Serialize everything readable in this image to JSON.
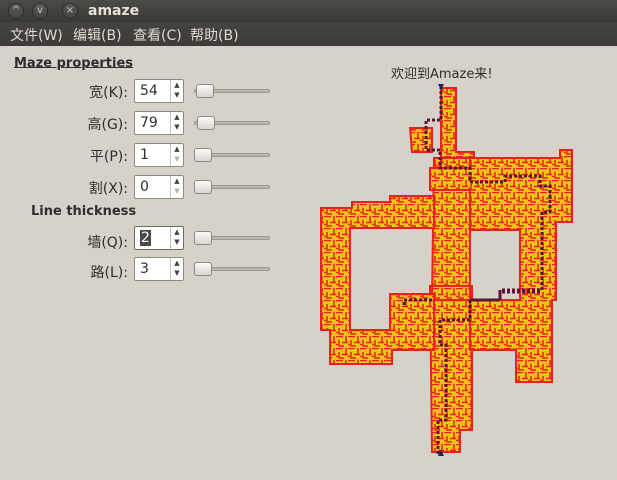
{
  "window": {
    "title": "amaze",
    "minimize_glyph": "^",
    "restore_glyph": "v",
    "close_glyph": "×"
  },
  "menu": [
    "文件(W)",
    "编辑(B)",
    "查看(C)",
    "帮助(B)"
  ],
  "maze_properties": {
    "title": "Maze properties",
    "rows": [
      {
        "label": "宽(K):",
        "value": "54"
      },
      {
        "label": "高(G):",
        "value": "79"
      },
      {
        "label": "平(P):",
        "value": "1"
      },
      {
        "label": "割(X):",
        "value": "0"
      }
    ]
  },
  "line_thickness": {
    "title": "Line thickness",
    "rows": [
      {
        "label": "墙(Q):",
        "value": "2"
      },
      {
        "label": "路(L):",
        "value": "3"
      }
    ]
  },
  "canvas": {
    "welcome": "欢迎到Amaze来!",
    "colors": {
      "wall": "#e6221c",
      "path": "#f2c21a",
      "solution": "#5a1535",
      "background": "#d6d2ca"
    }
  },
  "icons": [
    "window-minimize-icon",
    "window-maximize-icon",
    "window-close-icon",
    "spin-up-icon",
    "spin-down-icon"
  ]
}
